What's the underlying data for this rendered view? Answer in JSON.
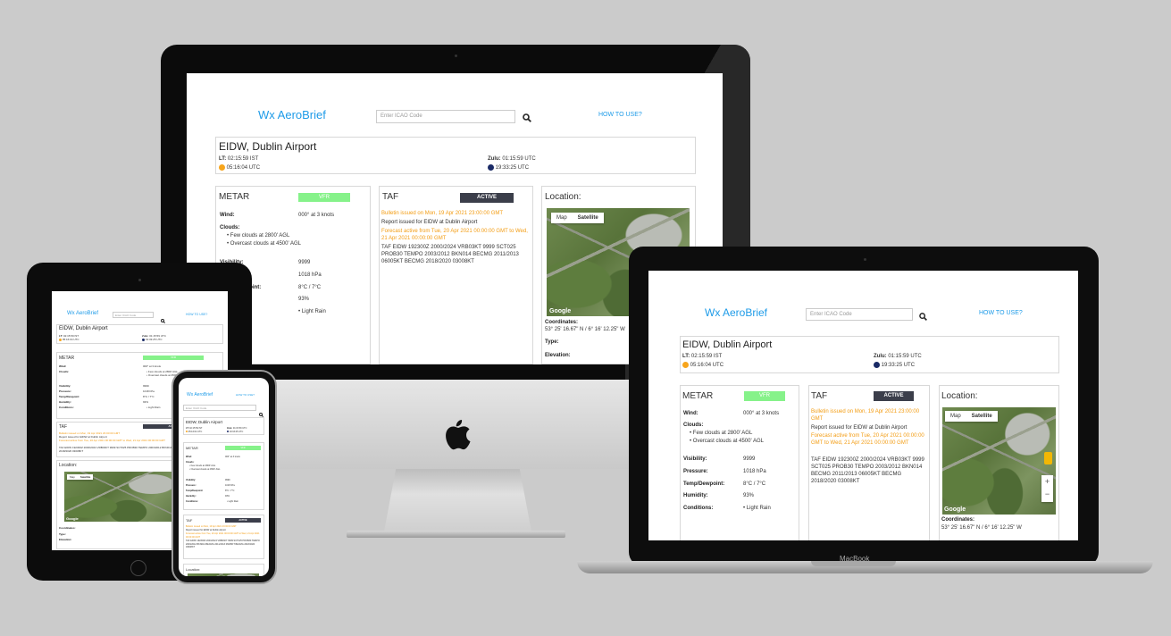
{
  "app": {
    "brand": "Wx AeroBrief",
    "search_placeholder": "Enter ICAO Code",
    "howto": "HOW TO USE?",
    "airport": "EIDW, Dublin Airport",
    "lt_label": "LT:",
    "lt_value": "02:15:59 IST",
    "sunrise": "05:16:04 UTC",
    "zulu_label": "Zulu:",
    "zulu_value": "01:15:59 UTC",
    "sunset": "19:33:25 UTC"
  },
  "metar": {
    "title": "METAR",
    "category": "VFR",
    "wind_label": "Wind:",
    "wind": "000° at 3 knots",
    "clouds_label": "Clouds:",
    "clouds": [
      "Few clouds at 2800' AGL",
      "Overcast clouds at 4500' AGL"
    ],
    "visibility_label": "Visibility:",
    "visibility": "9999",
    "pressure_label": "Pressure:",
    "pressure": "1018 hPa",
    "temp_label": "Temp/Dewpoint:",
    "temp": "8°C / 7°C",
    "humidity_label": "Humidity:",
    "humidity": "93%",
    "conditions_label": "Conditions:",
    "conditions": "Light Rain"
  },
  "taf": {
    "title": "TAF",
    "status": "ACTIVE",
    "bulletin": "Bulletin issued on Mon, 19 Apr 2021 23:00:00 GMT",
    "report": "Report issued for EIDW at Dublin Airport",
    "forecast": "Forecast active from Tue, 20 Apr 2021 00:00:00 GMT to Wed, 21 Apr 2021 00:00:00 GMT",
    "raw": "TAF EIDW 192300Z 2000/2024 VRB03KT 9999 SCT025 PROB30 TEMPO 2003/2012 BKN014 BECMG 2011/2013 06005KT BECMG 2018/2020 03008KT"
  },
  "location": {
    "title": "Location:",
    "map_btn": "Map",
    "sat_btn": "Satellite",
    "google": "Google",
    "coords_label": "Coordinates:",
    "coords": "53° 25' 16.67\" N / 6° 16' 12.25\" W",
    "type_label": "Type:",
    "elevation_label": "Elevation:"
  },
  "device": {
    "laptop_label": "MacBook"
  },
  "colors": {
    "brand": "#1e9be8",
    "vfr": "#86f28a",
    "active": "#3b3e4a",
    "highlight": "#f39c12"
  }
}
